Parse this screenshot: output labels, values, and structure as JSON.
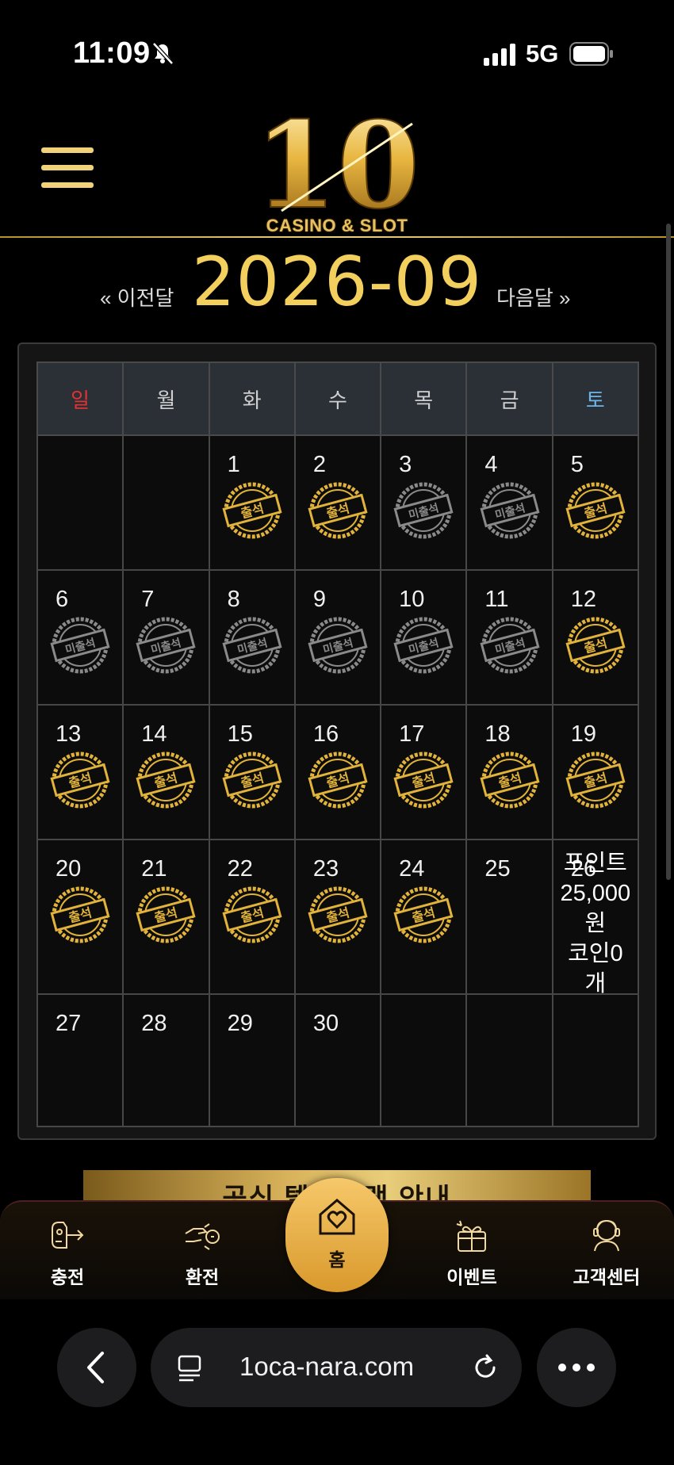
{
  "status_bar": {
    "time": "11:09",
    "network": "5G"
  },
  "header": {
    "logo_number": "10",
    "logo_text": "CASINO & SLOT"
  },
  "month_nav": {
    "prev_label": "« 이전달",
    "title": "2026-09",
    "next_label": "다음달 »"
  },
  "calendar": {
    "weekdays": [
      "일",
      "월",
      "화",
      "수",
      "목",
      "금",
      "토"
    ],
    "weeks": [
      [
        {
          "day": "",
          "status": ""
        },
        {
          "day": "",
          "status": ""
        },
        {
          "day": "1",
          "status": "출석"
        },
        {
          "day": "2",
          "status": "출석"
        },
        {
          "day": "3",
          "status": "미출석"
        },
        {
          "day": "4",
          "status": "미출석"
        },
        {
          "day": "5",
          "status": "출석"
        }
      ],
      [
        {
          "day": "6",
          "status": "미출석"
        },
        {
          "day": "7",
          "status": "미출석"
        },
        {
          "day": "8",
          "status": "미출석"
        },
        {
          "day": "9",
          "status": "미출석"
        },
        {
          "day": "10",
          "status": "미출석"
        },
        {
          "day": "11",
          "status": "미출석"
        },
        {
          "day": "12",
          "status": "출석"
        }
      ],
      [
        {
          "day": "13",
          "status": "출석"
        },
        {
          "day": "14",
          "status": "출석"
        },
        {
          "day": "15",
          "status": "출석"
        },
        {
          "day": "16",
          "status": "출석"
        },
        {
          "day": "17",
          "status": "출석"
        },
        {
          "day": "18",
          "status": "출석"
        },
        {
          "day": "19",
          "status": "출석"
        }
      ],
      [
        {
          "day": "20",
          "status": "출석"
        },
        {
          "day": "21",
          "status": "출석"
        },
        {
          "day": "22",
          "status": "출석"
        },
        {
          "day": "23",
          "status": "출석"
        },
        {
          "day": "24",
          "status": "출석"
        },
        {
          "day": "25",
          "status": ""
        },
        {
          "day": "26",
          "status": ""
        }
      ],
      [
        {
          "day": "27",
          "status": ""
        },
        {
          "day": "28",
          "status": ""
        },
        {
          "day": "29",
          "status": ""
        },
        {
          "day": "30",
          "status": ""
        },
        {
          "day": "",
          "status": ""
        },
        {
          "day": "",
          "status": ""
        },
        {
          "day": "",
          "status": ""
        }
      ]
    ],
    "popup_lines": [
      "포인트",
      "25,000",
      "원",
      "코인0",
      "개"
    ]
  },
  "banner": {
    "text": "공식 텔레그램 안내"
  },
  "bottom_nav": {
    "items": [
      {
        "label": "충전",
        "icon": "charge-icon"
      },
      {
        "label": "환전",
        "icon": "exchange-icon"
      },
      {
        "label": "홈",
        "icon": "home-icon"
      },
      {
        "label": "이벤트",
        "icon": "gift-icon"
      },
      {
        "label": "고객센터",
        "icon": "support-icon"
      }
    ]
  },
  "browser": {
    "url": "1oca-nara.com"
  },
  "colors": {
    "gold": "#f3cf5e",
    "stamp_gold": "#e2b33a",
    "stamp_gray": "#8a8a8a",
    "sunday": "#e23232",
    "saturday": "#6bb6e8"
  }
}
